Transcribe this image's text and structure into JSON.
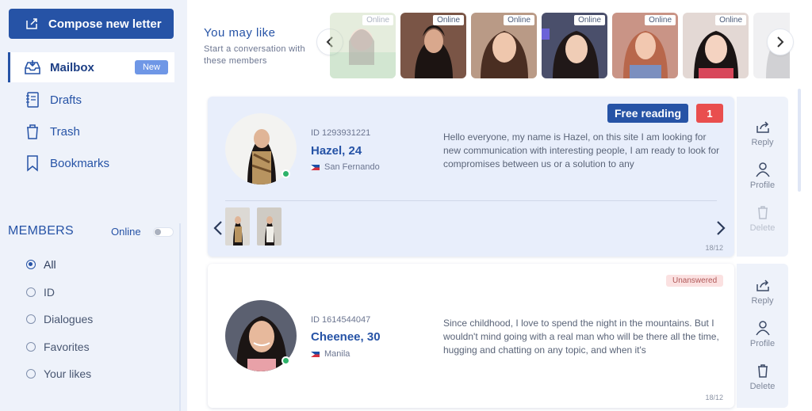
{
  "sidebar": {
    "compose_label": "Compose new letter",
    "nav": [
      {
        "label": "Mailbox",
        "badge": "New"
      },
      {
        "label": "Drafts"
      },
      {
        "label": "Trash"
      },
      {
        "label": "Bookmarks"
      }
    ],
    "members_title": "MEMBERS",
    "online_label": "Online",
    "filters": [
      "All",
      "ID",
      "Dialogues",
      "Favorites",
      "Your likes"
    ]
  },
  "suggest": {
    "title": "You may like",
    "subtitle": "Start a conversation with these members",
    "online_badge": "Online"
  },
  "letters": [
    {
      "id": "ID 1293931221",
      "name": "Hazel, 24",
      "location": "San Fernando",
      "message": "Hello everyone, my name is Hazel, on this site I am looking for new communication with interesting people, I am ready to look for compromises between us or a solution to any",
      "free_label": "Free reading",
      "count": "1",
      "date": "18/12"
    },
    {
      "id": "ID 1614544047",
      "name": "Cheenee, 30",
      "location": "Manila",
      "message": "Since childhood, I love to spend the night in the mountains. But I wouldn't mind going with a real man who will be there all the time, hugging and chatting on any topic, and when it's",
      "status": "Unanswered",
      "date": "18/12"
    }
  ],
  "actions": {
    "reply": "Reply",
    "profile": "Profile",
    "delete": "Delete"
  },
  "colors": {
    "primary": "#2653a6",
    "online": "#2fb36a",
    "alert": "#e94e4e"
  }
}
